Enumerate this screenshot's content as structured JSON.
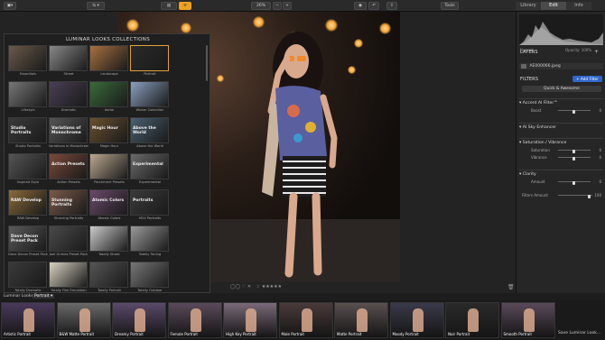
{
  "toolbar": {
    "zoom": "26%",
    "tools_label": "Tools",
    "tabs": [
      {
        "label": "Library",
        "active": false
      },
      {
        "label": "Edit",
        "active": true
      },
      {
        "label": "Info",
        "active": false
      }
    ]
  },
  "looks_panel": {
    "title": "LUMINAR LOOKS COLLECTIONS",
    "items": [
      {
        "label": "Essentials",
        "thumb_text": ""
      },
      {
        "label": "Street",
        "thumb_text": ""
      },
      {
        "label": "Landscape",
        "thumb_text": ""
      },
      {
        "label": "Portrait",
        "thumb_text": ""
      },
      {
        "label": "Lifestyle",
        "thumb_text": ""
      },
      {
        "label": "Dramatic",
        "thumb_text": ""
      },
      {
        "label": "Aerial",
        "thumb_text": ""
      },
      {
        "label": "Winter Collection",
        "thumb_text": ""
      },
      {
        "label": "Studio Portraits",
        "thumb_text": "Studio Portraits"
      },
      {
        "label": "Variations in Monochrome",
        "thumb_text": "Variations of Monochrome"
      },
      {
        "label": "Magic Hour",
        "thumb_text": "Magic Hour"
      },
      {
        "label": "Above the World",
        "thumb_text": "Above the World"
      },
      {
        "label": "Inspired Style",
        "thumb_text": ""
      },
      {
        "label": "Action Presets",
        "thumb_text": "Action Presets"
      },
      {
        "label": "Parchment Presets",
        "thumb_text": ""
      },
      {
        "label": "Experimental",
        "thumb_text": "Experimental"
      },
      {
        "label": "RAW Develop",
        "thumb_text": "RAW Develop"
      },
      {
        "label": "Stunning Portraits",
        "thumb_text": "Stunning Portraits"
      },
      {
        "label": "Atomic Colors",
        "thumb_text": "Atomic Colors"
      },
      {
        "label": "M24 Portraits",
        "thumb_text": "Portraits"
      },
      {
        "label": "Dave Decon Preset Pack",
        "thumb_text": "Dave Decon Preset Pack"
      },
      {
        "label": "Joel Grimes Preset Pack",
        "thumb_text": ""
      },
      {
        "label": "Totally Street",
        "thumb_text": ""
      },
      {
        "label": "Totally Toning",
        "thumb_text": ""
      },
      {
        "label": "Totally Dramatic",
        "thumb_text": ""
      },
      {
        "label": "Totally Film Emulation",
        "thumb_text": ""
      },
      {
        "label": "Totally Portrait",
        "thumb_text": ""
      },
      {
        "label": "Totally Outdoor",
        "thumb_text": ""
      }
    ]
  },
  "photo_bar": {
    "rating": "☆ ★★★★★",
    "flags": "◯◯ ♡ ✕"
  },
  "sidebar": {
    "normal_label": "Normal",
    "opacity_label": "Opacity: 100%",
    "layers_title": "LAYERS",
    "layer_file": "AE000066.jpeg",
    "filters_title": "FILTERS",
    "add_filter": "+ Add Filter",
    "quick_awesome": "Quick & Awesome",
    "sections": [
      {
        "title": "Accent AI Filter™",
        "sliders": [
          {
            "label": "Boost",
            "value": "0"
          }
        ]
      },
      {
        "title": "AI Sky Enhancer",
        "sliders": [
          {
            "label": "AI Sky Enhancer",
            "value": "0"
          }
        ]
      },
      {
        "title": "Saturation / Vibrance",
        "sliders": [
          {
            "label": "Saturation",
            "value": "0"
          },
          {
            "label": "Vibrance",
            "value": "0"
          }
        ]
      },
      {
        "title": "Clarity",
        "sliders": [
          {
            "label": "Amount",
            "value": "0"
          }
        ]
      }
    ],
    "filters_amount_label": "Filters Amount",
    "filters_amount_value": "100"
  },
  "strip": {
    "header_label": "Luminar Looks:",
    "header_value": "Portrait ▾",
    "save_label": "Save Luminar Look...",
    "items": [
      {
        "label": "Artistic Portrait"
      },
      {
        "label": "B&W Matte Portrait"
      },
      {
        "label": "Dreamy Portrait"
      },
      {
        "label": "Female Portrait"
      },
      {
        "label": "High Key Portrait"
      },
      {
        "label": "Male Portrait"
      },
      {
        "label": "Matte Portrait"
      },
      {
        "label": "Moody Portrait"
      },
      {
        "label": "Noir Portrait"
      },
      {
        "label": "Smooth Portrait"
      }
    ]
  }
}
